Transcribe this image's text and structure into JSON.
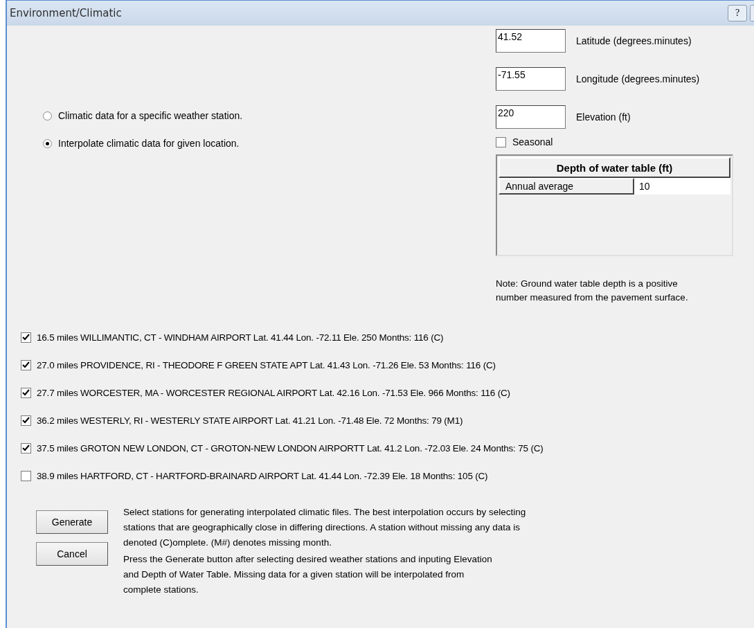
{
  "window": {
    "title": "Environment/Climatic",
    "help_button": "?"
  },
  "radios": [
    {
      "label": "Climatic data for a specific weather station.",
      "selected": false
    },
    {
      "label": "Interpolate climatic data  for given location.",
      "selected": true
    }
  ],
  "fields": [
    {
      "value": "41.52",
      "label": "Latitude (degrees.minutes)"
    },
    {
      "value": "-71.55",
      "label": "Longitude (degrees.minutes)"
    },
    {
      "value": "220",
      "label": "Elevation (ft)"
    }
  ],
  "seasonal": {
    "label": "Seasonal",
    "checked": false
  },
  "depth_table": {
    "header": "Depth of water table (ft)",
    "rows": [
      {
        "label": "Annual average",
        "value": "10"
      }
    ]
  },
  "note": [
    "Note: Ground water table depth is a positive",
    "number measured from the pavement surface."
  ],
  "stations": [
    {
      "label": "16.5 miles WILLIMANTIC, CT - WINDHAM AIRPORT  Lat. 41.44  Lon. -72.11  Ele. 250  Months: 116 (C)",
      "checked": true
    },
    {
      "label": "27.0 miles PROVIDENCE, RI - THEODORE F GREEN STATE APT  Lat. 41.43  Lon. -71.26  Ele. 53  Months: 116 (C)",
      "checked": true
    },
    {
      "label": "27.7 miles WORCESTER, MA - WORCESTER REGIONAL AIRPORT  Lat. 42.16  Lon. -71.53  Ele. 966  Months: 116 (C)",
      "checked": true
    },
    {
      "label": "36.2 miles WESTERLY, RI - WESTERLY STATE AIRPORT  Lat. 41.21  Lon. -71.48  Ele. 72  Months: 79 (M1)",
      "checked": true
    },
    {
      "label": "37.5 miles GROTON NEW LONDON, CT - GROTON-NEW LONDON AIRPORTT  Lat. 41.2  Lon. -72.03  Ele. 24  Months: 75 (C)",
      "checked": true
    },
    {
      "label": "38.9 miles HARTFORD, CT - HARTFORD-BRAINARD AIRPORT  Lat. 41.44  Lon. -72.39  Ele. 18  Months: 105 (C)",
      "checked": false
    }
  ],
  "buttons": [
    "Generate",
    "Cancel"
  ],
  "help_text": [
    [
      "Select stations for generating interpolated climatic files.   The best interpolation occurs by selecting",
      "stations that are geographically close in differing directions. A station without missing any data is",
      "denoted (C)omplete. (M#) denotes missing month."
    ],
    [
      "Press the Generate button after selecting desired weather stations and inputing Elevation",
      "and Depth of Water Table.  Missing data for a given station will be interpolated from",
      "complete stations."
    ]
  ]
}
